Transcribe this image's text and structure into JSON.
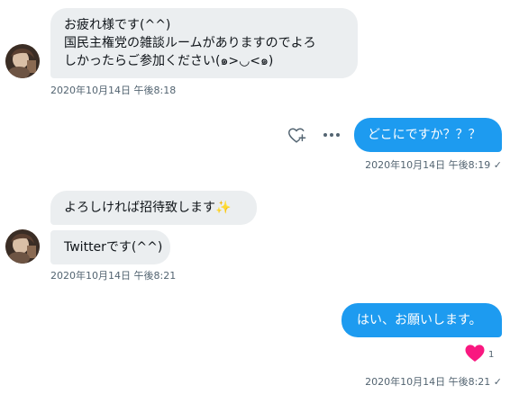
{
  "messages": {
    "m1": {
      "lines": [
        "お疲れ様です(^^)",
        "国民主権党の雑談ルームがありますのでよろ",
        "しかったらご参加ください(๑>◡<๑)"
      ],
      "timestamp": "2020年10月14日 午後8:18"
    },
    "m2": {
      "text": "どこにですか？？？",
      "timestamp": "2020年10月14日 午後8:19 ✓"
    },
    "m3": {
      "text": "よろしければ招待致します✨"
    },
    "m4": {
      "text": "Twitterです(^^)",
      "timestamp": "2020年10月14日 午後8:21"
    },
    "m5": {
      "text": "はい、お願いします。",
      "reaction_count": "1",
      "timestamp": "2020年10月14日 午後8:21 ✓"
    }
  },
  "icons": {
    "react": "heart-plus-icon",
    "more": "more-horizontal-icon",
    "reaction": "heart-filled-icon"
  },
  "colors": {
    "outgoing_bubble": "#1d9bf0",
    "incoming_bubble": "#ebeef0",
    "timestamp": "#536471",
    "heart": "#f91880"
  }
}
